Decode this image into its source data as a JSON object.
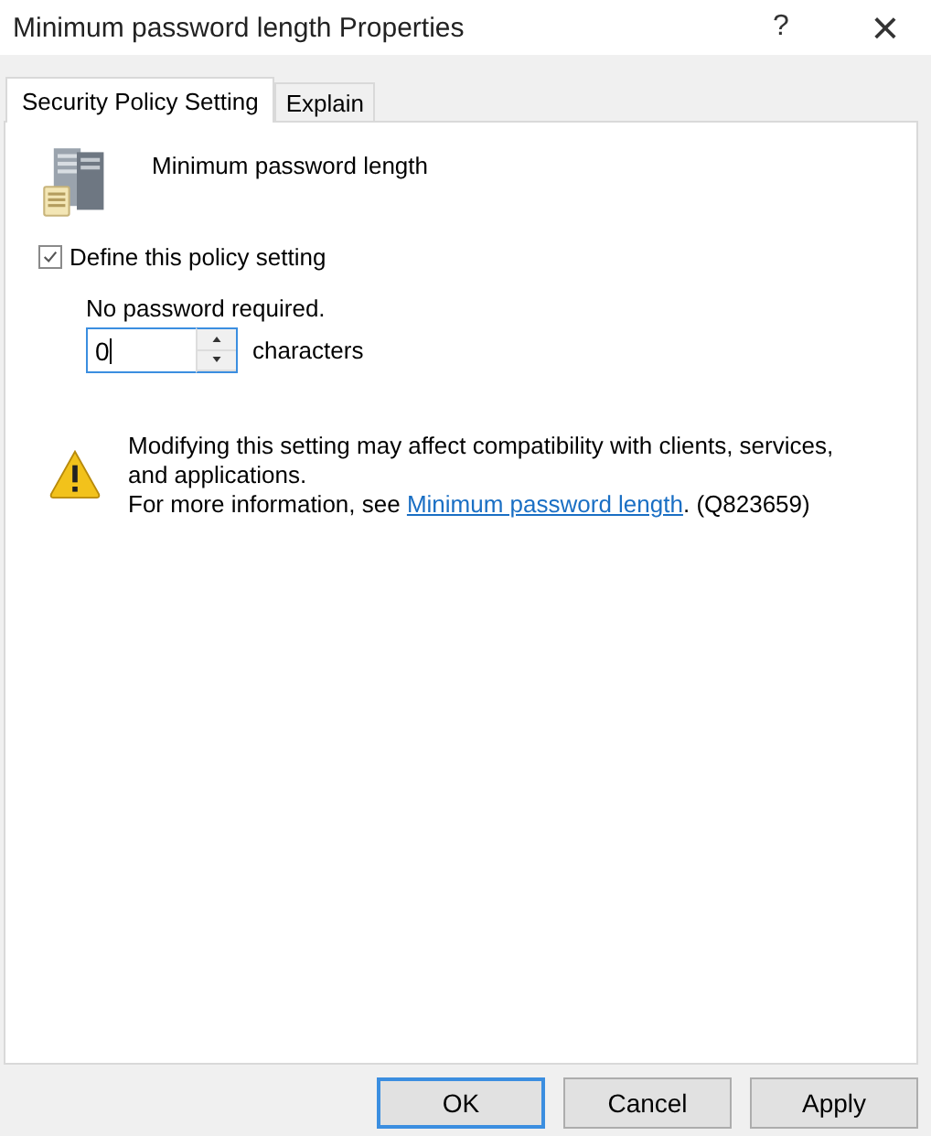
{
  "window": {
    "title": "Minimum password length Properties",
    "help": "?",
    "close": "×"
  },
  "tabs": [
    {
      "label": "Security Policy Setting",
      "selected": true
    },
    {
      "label": "Explain",
      "selected": false
    }
  ],
  "policy": {
    "name": "Minimum password length"
  },
  "define": {
    "label": "Define this policy setting",
    "checked": true
  },
  "setting": {
    "caption": "No password required.",
    "value": "0",
    "unit": "characters"
  },
  "warning": {
    "text": "Modifying this setting may affect compatibility with clients, services, and applications.",
    "more_prefix": "For more information, see ",
    "link": "Minimum password length",
    "more_suffix": ". (Q823659)"
  },
  "buttons": [
    {
      "label": "OK",
      "default": true
    },
    {
      "label": "Cancel",
      "default": false
    },
    {
      "label": "Apply",
      "default": false
    }
  ]
}
